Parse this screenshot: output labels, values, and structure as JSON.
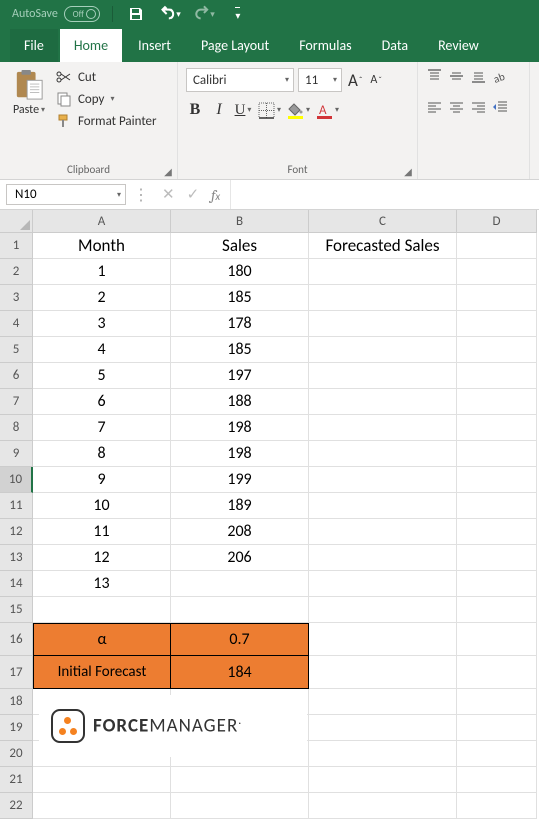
{
  "titlebar": {
    "autosave_label": "AutoSave",
    "autosave_state": "Off"
  },
  "ribbon": {
    "tabs": {
      "file": "File",
      "home": "Home",
      "insert": "Insert",
      "page_layout": "Page Layout",
      "formulas": "Formulas",
      "data": "Data",
      "review": "Review"
    },
    "clipboard": {
      "group_label": "Clipboard",
      "paste": "Paste",
      "cut": "Cut",
      "copy": "Copy",
      "format_painter": "Format Painter"
    },
    "font": {
      "group_label": "Font",
      "font_name": "Calibri",
      "font_size": "11",
      "bold": "B",
      "italic": "I",
      "underline": "U"
    }
  },
  "name_box": "N10",
  "formula_bar": "",
  "columns": {
    "A": "A",
    "B": "B",
    "C": "C",
    "D": "D"
  },
  "rows": [
    "1",
    "2",
    "3",
    "4",
    "5",
    "6",
    "7",
    "8",
    "9",
    "10",
    "11",
    "12",
    "13",
    "14",
    "15",
    "16",
    "17",
    "18",
    "19",
    "20",
    "21",
    "22"
  ],
  "sheet": {
    "headers": {
      "A": "Month",
      "B": "Sales",
      "C": "Forecasted Sales"
    },
    "data": [
      {
        "month": "1",
        "sales": "180"
      },
      {
        "month": "2",
        "sales": "185"
      },
      {
        "month": "3",
        "sales": "178"
      },
      {
        "month": "4",
        "sales": "185"
      },
      {
        "month": "5",
        "sales": "197"
      },
      {
        "month": "6",
        "sales": "188"
      },
      {
        "month": "7",
        "sales": "198"
      },
      {
        "month": "8",
        "sales": "198"
      },
      {
        "month": "9",
        "sales": "199"
      },
      {
        "month": "10",
        "sales": "189"
      },
      {
        "month": "11",
        "sales": "208"
      },
      {
        "month": "12",
        "sales": "206"
      },
      {
        "month": "13",
        "sales": ""
      }
    ],
    "params": {
      "alpha_label": "α",
      "alpha_value": "0.7",
      "initial_forecast_label": "Initial Forecast",
      "initial_forecast_value": "184"
    }
  },
  "logo": {
    "brand_bold": "FORCE",
    "brand_rest": "MANAGER"
  }
}
